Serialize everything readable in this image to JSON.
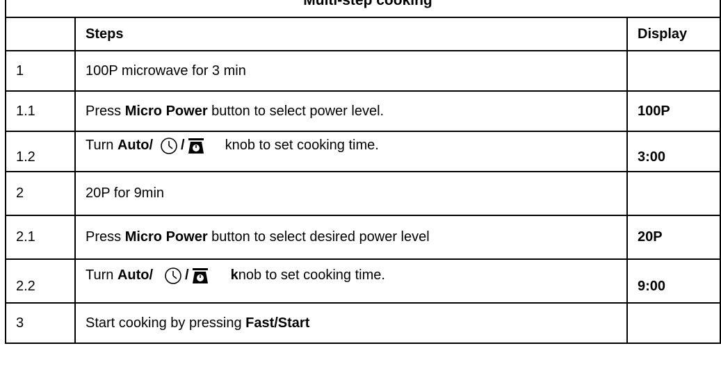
{
  "title": "Multi-step cooking",
  "headers": {
    "num": "",
    "steps": "Steps",
    "display": "Display"
  },
  "rows": [
    {
      "num": "1",
      "steps_plain": "100P microwave for 3 min",
      "display": ""
    },
    {
      "num": "1.1",
      "pre": "Press ",
      "bold": "Micro Power",
      "post": " button to select power level.",
      "display": "100P"
    },
    {
      "num": "1.2",
      "pre": "Turn ",
      "bold": "Auto/",
      "slash": "/",
      "post": "knob to set cooking time.",
      "display": "3:00"
    },
    {
      "num": "2",
      "steps_plain": "20P for 9min",
      "display": ""
    },
    {
      "num": "2.1",
      "pre": "Press ",
      "bold": "Micro Power",
      "post": " button to select desired power level",
      "display": "20P"
    },
    {
      "num": "2.2",
      "pre": "Turn ",
      "bold": "Auto/",
      "slash": "/",
      "bold2": "k",
      "post": "nob to set cooking time.",
      "display": "9:00"
    },
    {
      "num": "3",
      "pre": "Start cooking by pressing ",
      "bold": "Fast/Start",
      "display": ""
    }
  ],
  "icons": {
    "clock": "clock-icon",
    "scale": "weight-scale-icon"
  }
}
